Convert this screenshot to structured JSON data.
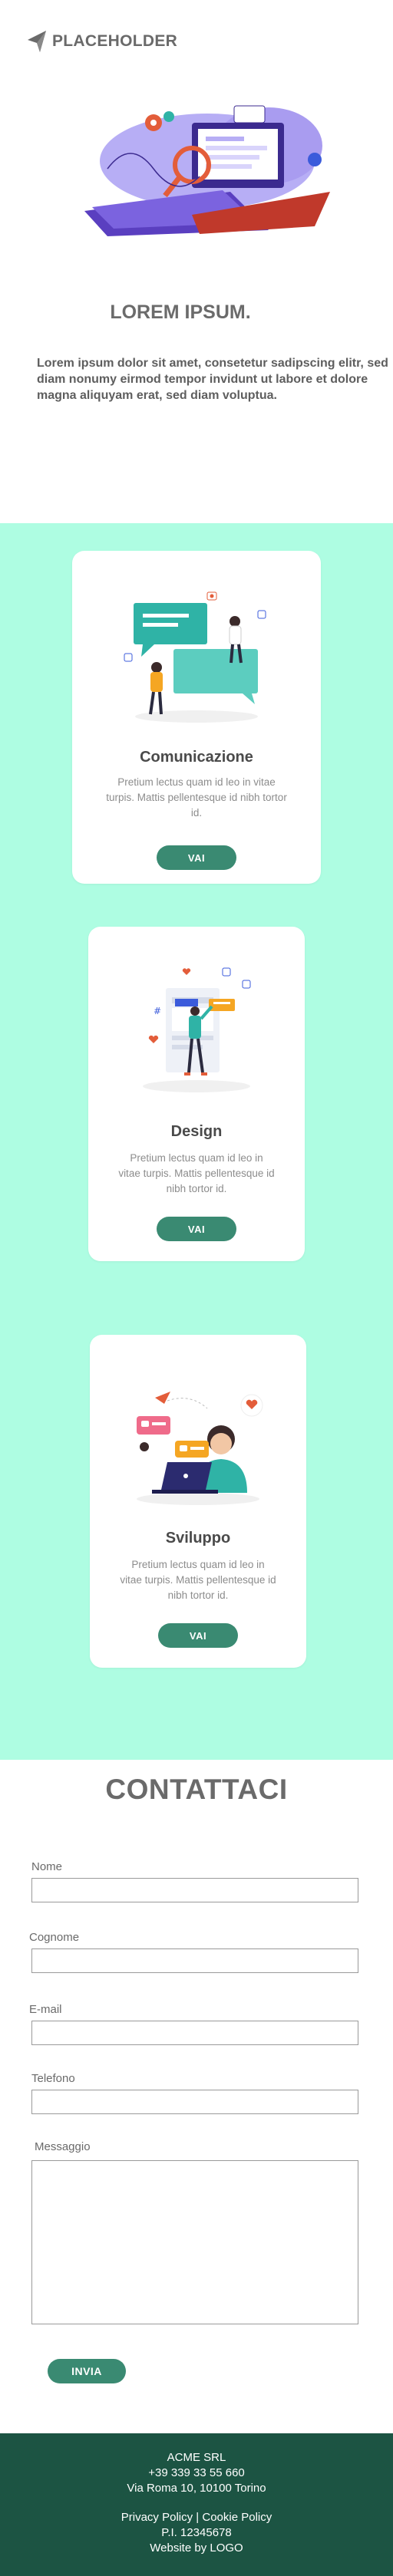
{
  "header": {
    "brand": "PLACEHOLDER"
  },
  "hero": {
    "title": "LOREM IPSUM.",
    "text_lines": [
      "Lorem ipsum dolor sit amet, consetetur sadipscing elitr, sed",
      "diam nonumy eirmod tempor invidunt ut labore et dolore",
      "magna aliquyam erat, sed diam voluptua."
    ]
  },
  "services": {
    "cards": [
      {
        "title": "Comunicazione",
        "desc_lines": [
          "Pretium lectus quam id leo in vitae",
          "turpis. Mattis pellentesque id nibh tortor",
          "id."
        ],
        "button": "VAI"
      },
      {
        "title": "Design",
        "desc_lines": [
          "Pretium lectus quam id leo in",
          "vitae turpis. Mattis pellentesque id",
          "nibh tortor id."
        ],
        "button": "VAI"
      },
      {
        "title": "Sviluppo",
        "desc_lines": [
          "Pretium lectus quam id leo in",
          "vitae turpis. Mattis pellentesque id",
          "nibh tortor id."
        ],
        "button": "VAI"
      }
    ]
  },
  "contact": {
    "title": "CONTATTACI",
    "fields": {
      "nome": {
        "label": "Nome",
        "value": ""
      },
      "cognome": {
        "label": "Cognome",
        "value": ""
      },
      "email": {
        "label": "E-mail",
        "value": ""
      },
      "telefono": {
        "label": "Telefono",
        "value": ""
      },
      "messaggio": {
        "label": "Messaggio",
        "value": ""
      }
    },
    "submit": "INVIA"
  },
  "footer": {
    "company": "ACME SRL",
    "phone": "+39 339 33 55 660",
    "address": "Via Roma 10, 10100 Torino",
    "privacy": "Privacy Policy",
    "separator": "|",
    "cookie": "Cookie Policy",
    "vat": "P.I. 12345678",
    "credit": "Website by LOGO"
  },
  "colors": {
    "accent": "#3a8a72",
    "band": "#aefde2",
    "footer": "#1c5443",
    "illustration_teal": "#2fb3a6",
    "illustration_purple": "#a99cf0"
  }
}
